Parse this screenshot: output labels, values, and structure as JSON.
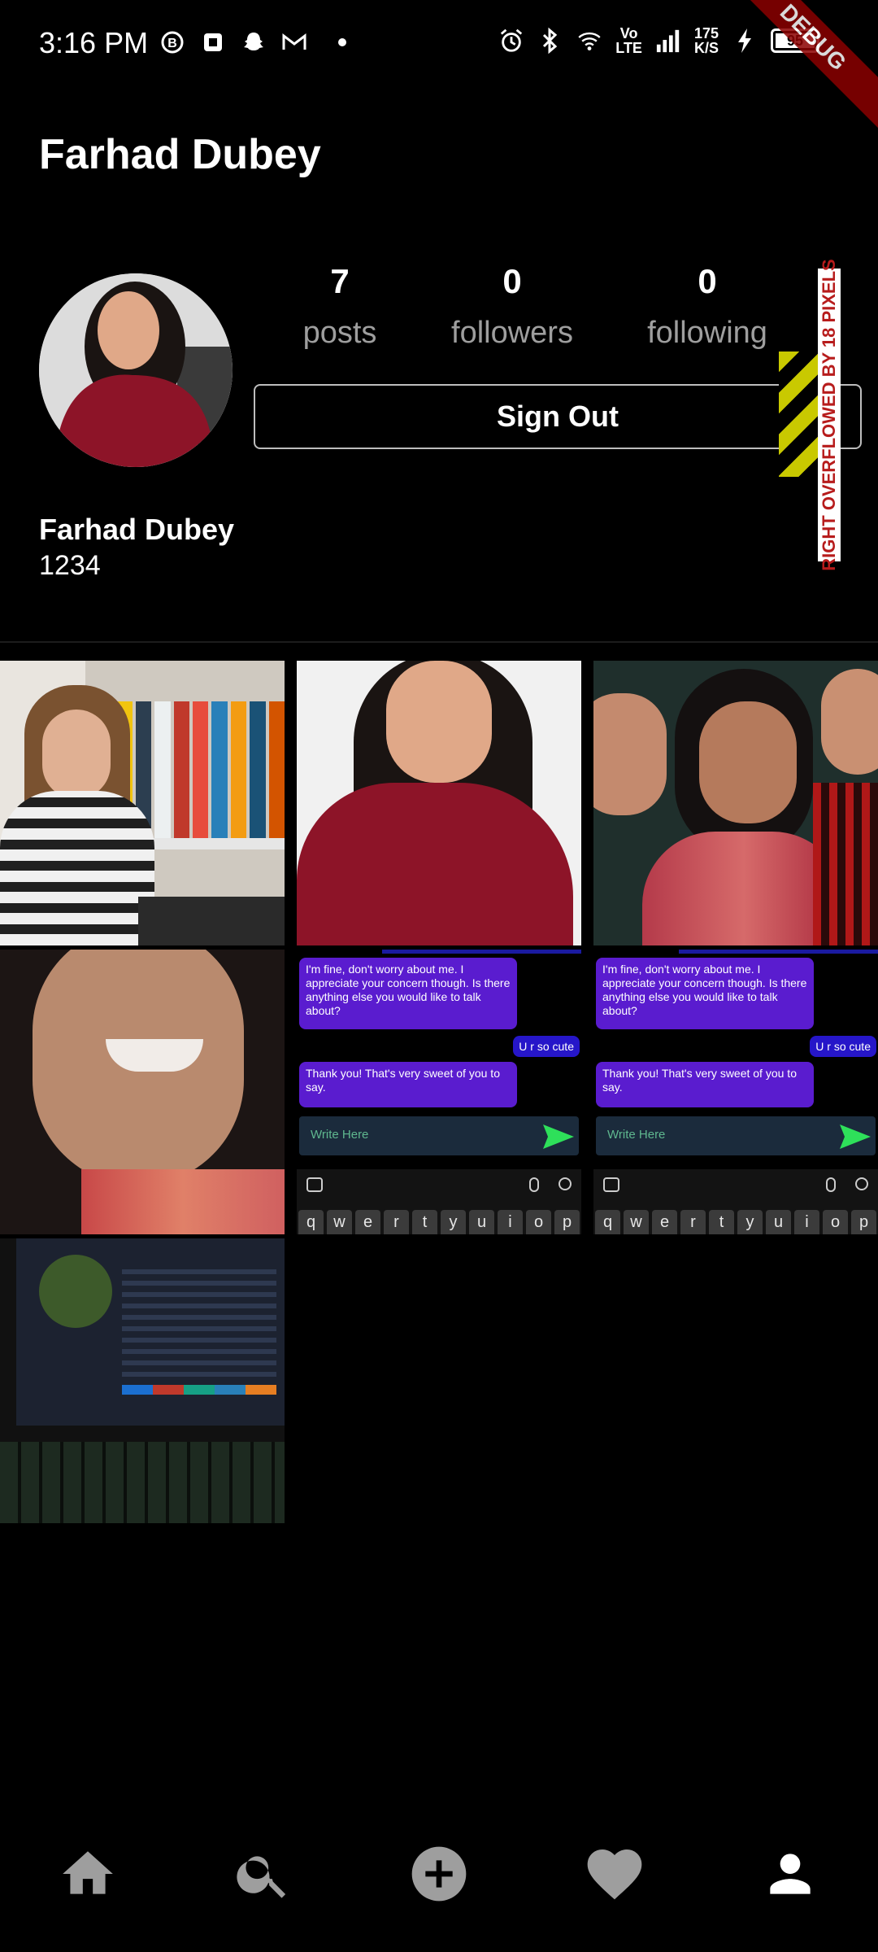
{
  "status_bar": {
    "time": "3:16 PM",
    "network_speed_value": "175",
    "network_speed_unit": "K/S",
    "volte_top": "Vo",
    "volte_bottom": "LTE",
    "battery": "95"
  },
  "debug_banner": "DEBUG",
  "app_bar": {
    "title": "Farhad Dubey"
  },
  "profile": {
    "stats": [
      {
        "value": "7",
        "label": "posts"
      },
      {
        "value": "0",
        "label": "followers"
      },
      {
        "value": "0",
        "label": "following"
      }
    ],
    "sign_out_label": "Sign Out",
    "overflow_warning": "RIGHT OVERFLOWED BY 18 PIXELS",
    "name": "Farhad Dubey",
    "bio": "1234"
  },
  "chat_preview": {
    "incoming_1": "I'm fine, don't worry about me. I appreciate your concern though. Is there anything else you would like to talk about?",
    "outgoing_1": "U r so cute",
    "incoming_2": "Thank you! That's very sweet of you to say.",
    "input_placeholder": "Write Here",
    "keyboard_row": [
      "q",
      "w",
      "e",
      "r",
      "t",
      "y",
      "u",
      "i",
      "o",
      "p"
    ]
  },
  "bottom_nav": {
    "items": [
      {
        "icon": "home-icon",
        "active": false
      },
      {
        "icon": "search-icon",
        "active": false
      },
      {
        "icon": "add-circle-icon",
        "active": false
      },
      {
        "icon": "heart-icon",
        "active": false
      },
      {
        "icon": "person-icon",
        "active": true
      }
    ],
    "inactive_color": "#9e9e9e",
    "active_color": "#ffffff"
  }
}
